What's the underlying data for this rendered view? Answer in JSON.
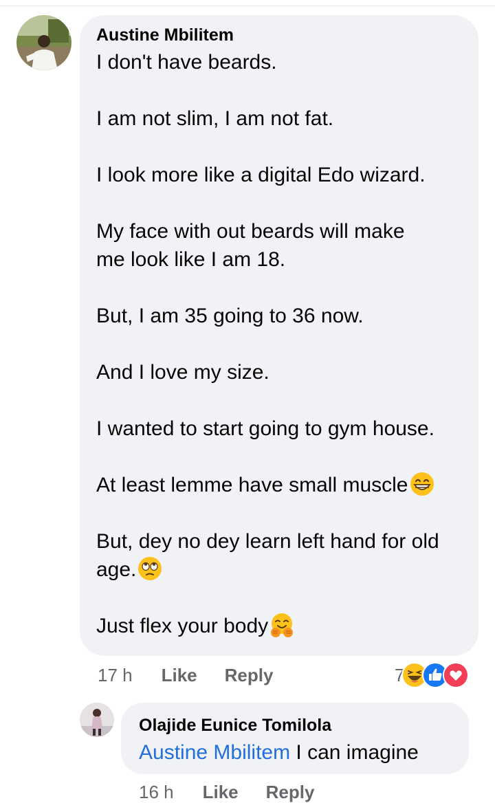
{
  "comment": {
    "author": "Austine Mbilitem",
    "paragraphs": [
      {
        "lines": [
          "I don't have beards."
        ]
      },
      {
        "lines": [
          "I am not slim, I am not fat."
        ]
      },
      {
        "lines": [
          "I look more like a digital Edo wizard."
        ]
      },
      {
        "lines": [
          "My face with out beards will make",
          "me look like I am 18."
        ]
      },
      {
        "lines": [
          "But, I am 35 going to 36 now."
        ]
      },
      {
        "lines": [
          "And I love my size."
        ]
      },
      {
        "lines": [
          "I wanted to start going to gym house."
        ]
      },
      {
        "lines": [
          "At least lemme have small muscle"
        ],
        "emoji": "grinning-face-emoji"
      },
      {
        "lines": [
          "But, dey no dey learn left hand for old",
          "age."
        ],
        "emoji": "eye-roll-emoji"
      },
      {
        "lines": [
          "Just flex your body"
        ],
        "emoji": "hugging-face-emoji"
      }
    ],
    "time": "17 h",
    "like_label": "Like",
    "reply_label": "Reply",
    "reaction_count": "7",
    "reaction_icons": [
      "haha-reaction-icon",
      "like-reaction-icon",
      "love-reaction-icon"
    ]
  },
  "reply": {
    "author": "Olajide Eunice Tomilola",
    "mention": "Austine Mbilitem",
    "text": "I can imagine",
    "time": "16 h",
    "like_label": "Like",
    "reply_label": "Reply"
  },
  "colors": {
    "bubble": "#f0f2f5",
    "meta_text": "#65676b",
    "mention": "#216fdb",
    "like_blue": "#1877f2",
    "love_red": "#f33e58",
    "emoji_yellow": "#fcc21b"
  }
}
